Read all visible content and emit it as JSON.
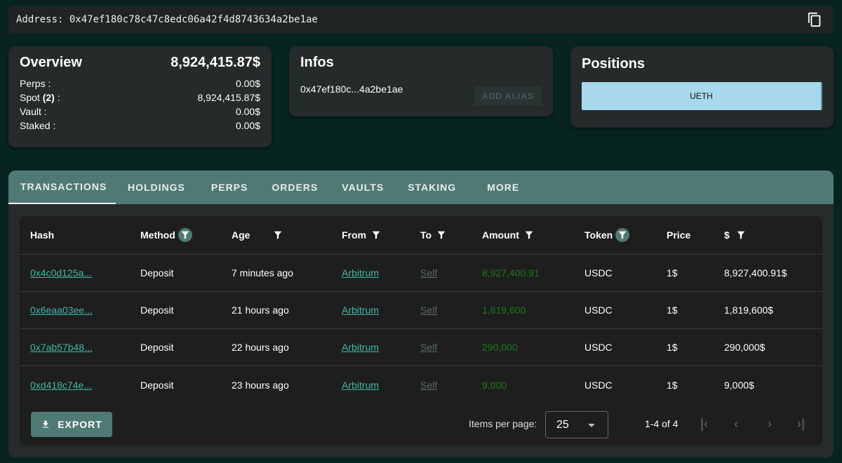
{
  "address": {
    "label": "Address: 0x47ef180c78c47c8edc06a42f4d8743634a2be1ae"
  },
  "overview": {
    "title": "Overview",
    "total": "8,924,415.87$",
    "rows": [
      {
        "label": "Perps :",
        "value": "0.00$"
      },
      {
        "label": "Spot ",
        "count": "(2)",
        "suffix": " :",
        "value": "8,924,415.87$"
      },
      {
        "label": "Vault :",
        "value": "0.00$"
      },
      {
        "label": "Staked :",
        "value": "0.00$"
      }
    ]
  },
  "infos": {
    "title": "Infos",
    "address_short": "0x47ef180c...4a2be1ae",
    "add_alias": "ADD ALIAS"
  },
  "positions": {
    "title": "Positions",
    "items": [
      "UETH"
    ]
  },
  "tabs": [
    "TRANSACTIONS",
    "HOLDINGS",
    "PERPS",
    "ORDERS",
    "VAULTS",
    "STAKING",
    "MORE"
  ],
  "table": {
    "headers": [
      "Hash",
      "Method",
      "Age",
      "From",
      "To",
      "Amount",
      "Token",
      "Price",
      "$"
    ],
    "rows": [
      [
        "0x4c0d125a...",
        "Deposit",
        "7 minutes ago",
        "Arbitrum",
        "Self",
        "8,927,400.91",
        "USDC",
        "1$",
        "8,927,400.91$"
      ],
      [
        "0x6eaa03ee...",
        "Deposit",
        "21 hours ago",
        "Arbitrum",
        "Self",
        "1,819,600",
        "USDC",
        "1$",
        "1,819,600$"
      ],
      [
        "0x7ab57b48...",
        "Deposit",
        "22 hours ago",
        "Arbitrum",
        "Self",
        "290,000",
        "USDC",
        "1$",
        "290,000$"
      ],
      [
        "0xd418c74e...",
        "Deposit",
        "23 hours ago",
        "Arbitrum",
        "Self",
        "9,000",
        "USDC",
        "1$",
        "9,000$"
      ]
    ]
  },
  "footer": {
    "export": "EXPORT",
    "items_per_page_label": "Items per page:",
    "items_per_page": "25",
    "range": "1-4 of 4"
  }
}
